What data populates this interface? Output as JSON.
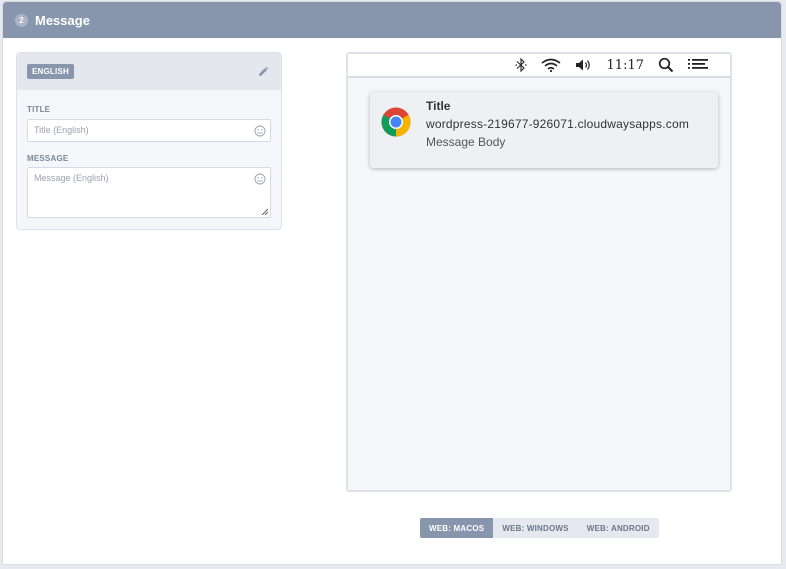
{
  "header": {
    "step": "2",
    "title": "Message"
  },
  "language_card": {
    "language": "ENGLISH",
    "title_label": "TITLE",
    "title_placeholder": "Title (English)",
    "title_value": "",
    "message_label": "MESSAGE",
    "message_placeholder": "Message (English)",
    "message_value": ""
  },
  "preview": {
    "menubar": {
      "clock": "11:17",
      "icons": [
        "bluetooth-icon",
        "wifi-icon",
        "volume-icon",
        "search-icon",
        "list-icon"
      ]
    },
    "notification": {
      "title": "Title",
      "origin": "wordpress-219677-926071.cloudwaysapps.com",
      "body": "Message Body",
      "icon": "chrome-icon"
    }
  },
  "platform_tabs": {
    "items": [
      "WEB: MACOS",
      "WEB: WINDOWS",
      "WEB: ANDROID"
    ],
    "selected": "WEB: MACOS"
  },
  "colors": {
    "accent": "#8795ad",
    "panel_bg": "#f4f6f9"
  }
}
